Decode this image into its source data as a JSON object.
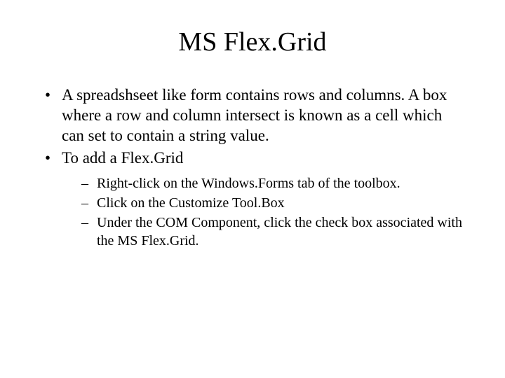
{
  "title": "MS Flex.Grid",
  "bullets": [
    {
      "text": "A spreadshseet like form contains rows and columns.  A box where a row and column intersect is known as a cell which can set to contain a string value."
    },
    {
      "text": "To add a Flex.Grid",
      "sub": [
        "Right-click on the Windows.Forms tab of the toolbox.",
        "Click on the Customize Tool.Box",
        "Under the COM Component, click the check box associated with the MS Flex.Grid."
      ]
    }
  ]
}
